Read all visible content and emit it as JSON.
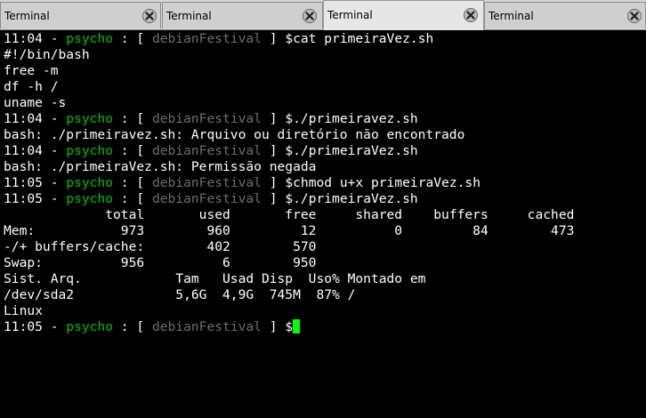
{
  "tabs": [
    {
      "label": "Terminal",
      "active": false
    },
    {
      "label": "Terminal",
      "active": false
    },
    {
      "label": "Terminal",
      "active": true
    },
    {
      "label": "Terminal",
      "active": false
    }
  ],
  "prompt": {
    "user": "psycho",
    "host": "debianFestival",
    "separator": " - ",
    "open": " : [ ",
    "close": " ] $"
  },
  "colors": {
    "background": "#000000",
    "text": "#ffffff",
    "user": "#00c000",
    "host": "#6e6e6e",
    "cursor": "#00ff00"
  },
  "terminal": {
    "lines": [
      {
        "type": "prompt",
        "time": "11:04",
        "cmd": "cat primeiraVez.sh"
      },
      {
        "type": "out",
        "text": "#!/bin/bash"
      },
      {
        "type": "out",
        "text": "free -m"
      },
      {
        "type": "out",
        "text": "df -h /"
      },
      {
        "type": "out",
        "text": "uname -s"
      },
      {
        "type": "prompt",
        "time": "11:04",
        "cmd": "./primeiravez.sh"
      },
      {
        "type": "out",
        "text": "bash: ./primeiravez.sh: Arquivo ou diretório não encontrado"
      },
      {
        "type": "prompt",
        "time": "11:04",
        "cmd": "./primeiraVez.sh"
      },
      {
        "type": "out",
        "text": "bash: ./primeiraVez.sh: Permissão negada"
      },
      {
        "type": "prompt",
        "time": "11:05",
        "cmd": "chmod u+x primeiraVez.sh"
      },
      {
        "type": "prompt",
        "time": "11:05",
        "cmd": "./primeiraVez.sh"
      },
      {
        "type": "out",
        "text": "             total       used       free     shared    buffers     cached"
      },
      {
        "type": "out",
        "text": "Mem:           973        960         12          0         84        473"
      },
      {
        "type": "out",
        "text": "-/+ buffers/cache:        402        570"
      },
      {
        "type": "out",
        "text": "Swap:          956          6        950"
      },
      {
        "type": "out",
        "text": "Sist. Arq.            Tam   Usad Disp  Uso% Montado em"
      },
      {
        "type": "out",
        "text": "/dev/sda2             5,6G  4,9G  745M  87% /"
      },
      {
        "type": "out",
        "text": "Linux"
      },
      {
        "type": "prompt",
        "time": "11:05",
        "cmd": "",
        "cursor": true
      }
    ]
  }
}
